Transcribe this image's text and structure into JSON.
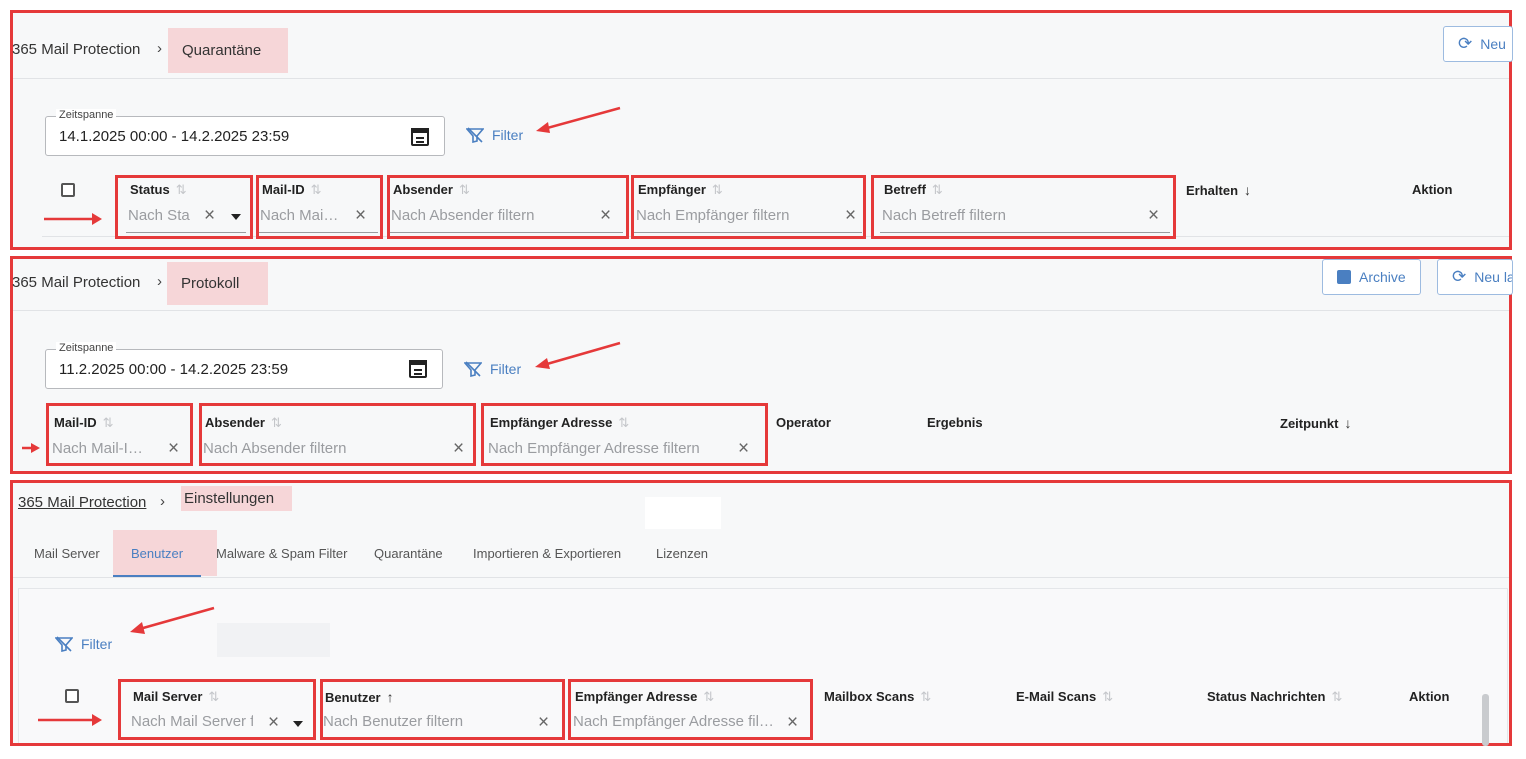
{
  "quarantine": {
    "breadcrumb_parent": "365 Mail Protection",
    "breadcrumb_current": "Quarantäne",
    "reload_label": "Neu",
    "date_label": "Zeitspanne",
    "date_value": "14.1.2025 00:00 - 14.2.2025 23:59",
    "filter_label": "Filter",
    "columns": {
      "status": "Status",
      "mail_id": "Mail-ID",
      "sender": "Absender",
      "recipient": "Empfänger",
      "subject": "Betreff",
      "received": "Erhalten",
      "action": "Aktion"
    },
    "placeholders": {
      "status": "Nach Sta",
      "mail_id": "Nach Mai…",
      "sender": "Nach Absender filtern",
      "recipient": "Nach Empfänger filtern",
      "subject": "Nach Betreff filtern"
    }
  },
  "protocol": {
    "breadcrumb_parent": "365 Mail Protection",
    "breadcrumb_current": "Protokoll",
    "archive_label": "Archive",
    "reload_label": "Neu la",
    "date_label": "Zeitspanne",
    "date_value": "11.2.2025 00:00 - 14.2.2025 23:59",
    "filter_label": "Filter",
    "columns": {
      "mail_id": "Mail-ID",
      "sender": "Absender",
      "recipient_address": "Empfänger Adresse",
      "operator": "Operator",
      "result": "Ergebnis",
      "time": "Zeitpunkt"
    },
    "placeholders": {
      "mail_id": "Nach Mail-I…",
      "sender": "Nach Absender filtern",
      "recipient_address": "Nach Empfänger Adresse filtern"
    }
  },
  "settings": {
    "breadcrumb_parent": "365 Mail Protection",
    "breadcrumb_current": "Einstellungen",
    "tabs": [
      "Mail Server",
      "Benutzer",
      "Malware & Spam Filter",
      "Quarantäne",
      "Importieren & Exportieren",
      "Lizenzen"
    ],
    "active_tab": "Benutzer",
    "filter_label": "Filter",
    "columns": {
      "mail_server": "Mail Server",
      "user": "Benutzer",
      "recipient_address": "Empfänger Adresse",
      "mailbox_scans": "Mailbox Scans",
      "email_scans": "E-Mail Scans",
      "status_messages": "Status Nachrichten",
      "action": "Aktion"
    },
    "placeholders": {
      "mail_server": "Nach Mail Server f",
      "user": "Nach Benutzer filtern",
      "recipient_address": "Nach Empfänger Adresse fil…"
    }
  },
  "icons": {
    "sort": "⇅",
    "sort_desc": "↓",
    "sort_asc": "↑",
    "clear": "×",
    "breadcrumb_separator": "›"
  },
  "colors": {
    "highlight_red": "#e5393a",
    "accent_blue": "#4a7fc1",
    "breadcrumb_highlight": "#f6d6d8"
  }
}
